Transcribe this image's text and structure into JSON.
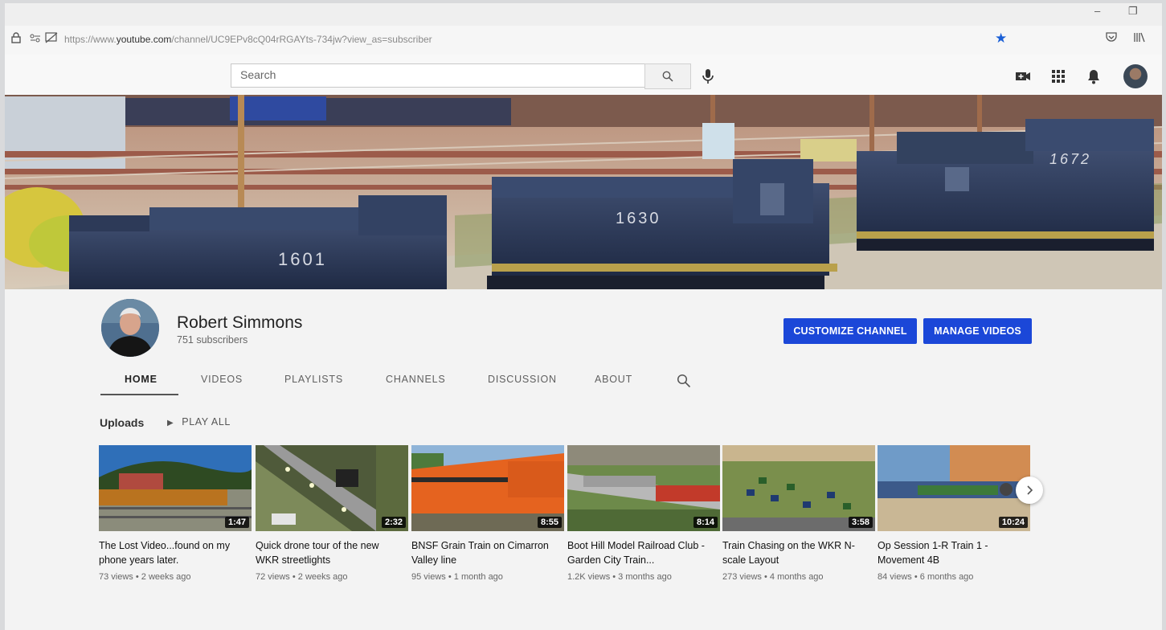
{
  "browser": {
    "url_prefix": "https://www.",
    "url_domain": "youtube.com",
    "url_suffix": "/channel/UC9EPv8cQ04rRGAYts-734jw?view_as=subscriber"
  },
  "header": {
    "search_placeholder": "Search"
  },
  "channel": {
    "name": "Robert Simmons",
    "subscribers": "751 subscribers",
    "customize_label": "CUSTOMIZE CHANNEL",
    "manage_label": "MANAGE VIDEOS"
  },
  "tabs": [
    {
      "label": "HOME",
      "active": true
    },
    {
      "label": "VIDEOS"
    },
    {
      "label": "PLAYLISTS"
    },
    {
      "label": "CHANNELS"
    },
    {
      "label": "DISCUSSION"
    },
    {
      "label": "ABOUT"
    }
  ],
  "uploads": {
    "heading": "Uploads",
    "play_all": "PLAY ALL"
  },
  "banner_numbers": [
    "1601",
    "1630",
    "1672"
  ],
  "videos": [
    {
      "title": "The Lost Video...found on my phone years later.",
      "duration": "1:47",
      "views": "73 views",
      "age": "2 weeks ago"
    },
    {
      "title": "Quick drone tour of the new WKR streetlights",
      "duration": "2:32",
      "views": "72 views",
      "age": "2 weeks ago"
    },
    {
      "title": "BNSF Grain Train on Cimarron Valley line",
      "duration": "8:55",
      "views": "95 views",
      "age": "1 month ago"
    },
    {
      "title": "Boot Hill Model Railroad Club - Garden City Train...",
      "duration": "8:14",
      "views": "1.2K views",
      "age": "3 months ago"
    },
    {
      "title": "Train Chasing on the WKR N-scale Layout",
      "duration": "3:58",
      "views": "273 views",
      "age": "4 months ago"
    },
    {
      "title": "Op Session 1-R Train 1 - Movement 4B",
      "duration": "10:24",
      "views": "84 views",
      "age": "6 months ago"
    }
  ],
  "meta_separator": " • ",
  "colors": {
    "accent": "#1b47d8",
    "bookmark_star": "#1a5fd6"
  }
}
